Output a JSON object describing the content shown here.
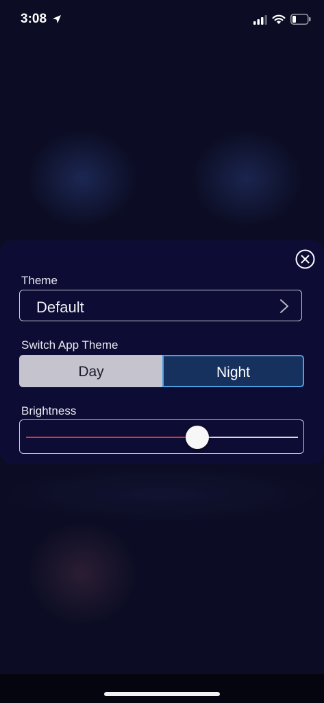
{
  "status_bar": {
    "time": "3:08",
    "icons": [
      "location-arrow-icon",
      "cellular-signal-icon",
      "wifi-icon",
      "battery-icon"
    ]
  },
  "settings_panel": {
    "close_icon": "close-circle-icon",
    "theme": {
      "label": "Theme",
      "selected_value": "Default",
      "chevron_icon": "chevron-right-icon"
    },
    "switch_app_theme": {
      "label": "Switch App Theme",
      "options": [
        "Day",
        "Night"
      ],
      "selected": "Night"
    },
    "brightness": {
      "label": "Brightness",
      "level": 0.63
    }
  },
  "colors": {
    "background": "#0c0d24",
    "panel": "#0d0c34",
    "segment_day": "#c5c4ce",
    "segment_night": "#17315e",
    "segment_night_border": "#4e9fe0",
    "slider_fill": "#d23a3a",
    "slider_track": "#d9d9de"
  }
}
